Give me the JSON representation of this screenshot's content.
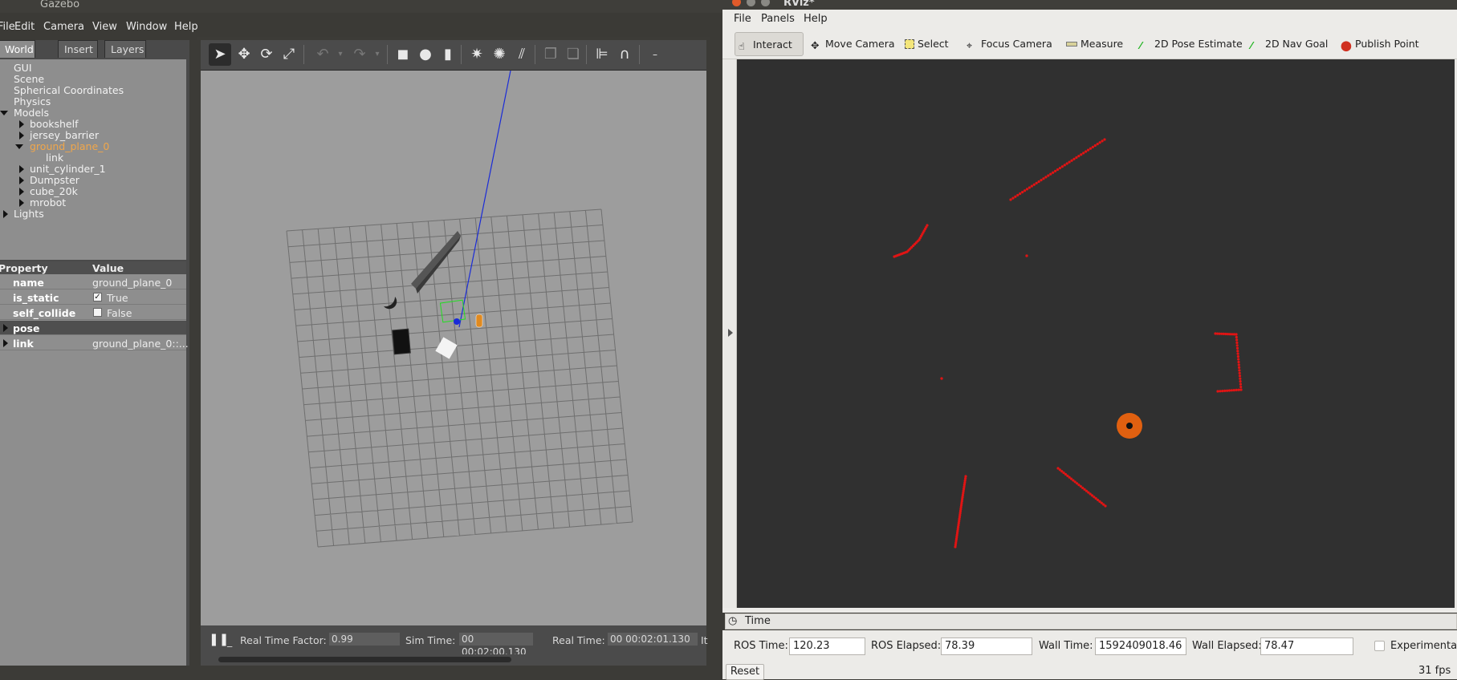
{
  "gazebo": {
    "title": "Gazebo",
    "menu": [
      "File",
      "Edit",
      "Camera",
      "View",
      "Window",
      "Help"
    ],
    "tabs": [
      "World",
      "Insert",
      "Layers"
    ],
    "tree": {
      "gui": "GUI",
      "scene": "Scene",
      "spherical": "Spherical Coordinates",
      "physics": "Physics",
      "models": "Models",
      "bookshelf": "bookshelf",
      "jersey_barrier": "jersey_barrier",
      "ground_plane_0": "ground_plane_0",
      "link": "link",
      "unit_cylinder_1": "unit_cylinder_1",
      "dumpster": "Dumpster",
      "cube_20k": "cube_20k",
      "mrobot": "mrobot",
      "lights": "Lights"
    },
    "props": {
      "header_property": "Property",
      "header_value": "Value",
      "name_key": "name",
      "name_val": "ground_plane_0",
      "static_key": "is_static",
      "static_val": "True",
      "collide_key": "self_collide",
      "collide_val": "False",
      "pose_key": "pose",
      "link_key": "link",
      "link_val": "ground_plane_0::..."
    },
    "status": {
      "rtf_label": "Real Time Factor:",
      "rtf_value": "0.99",
      "sim_label": "Sim Time:",
      "sim_value": "00 00:02:00.130",
      "real_label": "Real Time:",
      "real_value": "00 00:02:01.130",
      "iter_label": "It"
    }
  },
  "rviz": {
    "title": "RViz*",
    "menu": [
      "File",
      "Panels",
      "Help"
    ],
    "tools": [
      "Interact",
      "Move Camera",
      "Select",
      "Focus Camera",
      "Measure",
      "2D Pose Estimate",
      "2D Nav Goal",
      "Publish Point"
    ],
    "time": {
      "header": "Time",
      "ros_time_label": "ROS Time:",
      "ros_time": "120.23",
      "ros_elapsed_label": "ROS Elapsed:",
      "ros_elapsed": "78.39",
      "wall_time_label": "Wall Time:",
      "wall_time": "1592409018.46",
      "wall_elapsed_label": "Wall Elapsed:",
      "wall_elapsed": "78.47",
      "experimental": "Experimental",
      "reset": "Reset",
      "fps": "31 fps"
    },
    "colors": {
      "laser": "#e01414",
      "robot": "#e06010",
      "background": "#303030"
    }
  }
}
